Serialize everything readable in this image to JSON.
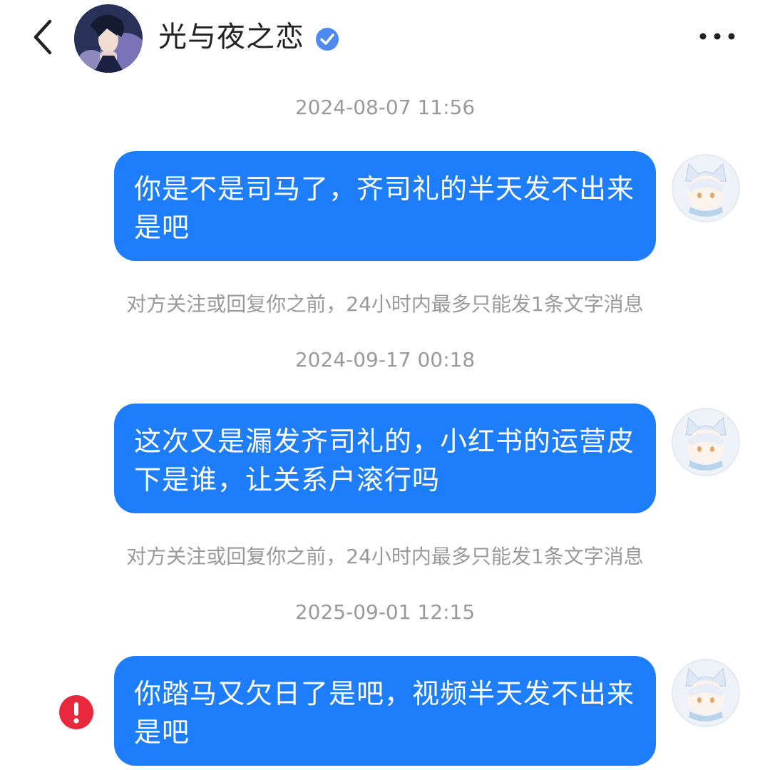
{
  "header": {
    "back_icon": "chevron-left-icon",
    "title": "光与夜之恋",
    "verified_icon": "verified-badge-icon",
    "more_icon": "more-horizontal-icon"
  },
  "conversation": [
    {
      "timestamp": "2024-08-07 11:56",
      "message": "你是不是司马了，齐司礼的半天发不出来是吧",
      "notice": "对方关注或回复你之前，24小时内最多只能发1条文字消息"
    },
    {
      "timestamp": "2024-09-17 00:18",
      "message": "这次又是漏发齐司礼的，小红书的运营皮下是谁，让关系户滚行吗",
      "notice": "对方关注或回复你之前，24小时内最多只能发1条文字消息"
    },
    {
      "timestamp": "2025-09-01 12:15",
      "message": "你踏马又欠日了是吧，视频半天发不出来是吧",
      "status_icon": "error-exclamation-icon"
    }
  ],
  "colors": {
    "bubble": "#1e7dfa",
    "bubble_text": "#ffffff",
    "meta_text": "#9a9a9a",
    "error": "#e8283d",
    "verified": "#4d8af0"
  }
}
